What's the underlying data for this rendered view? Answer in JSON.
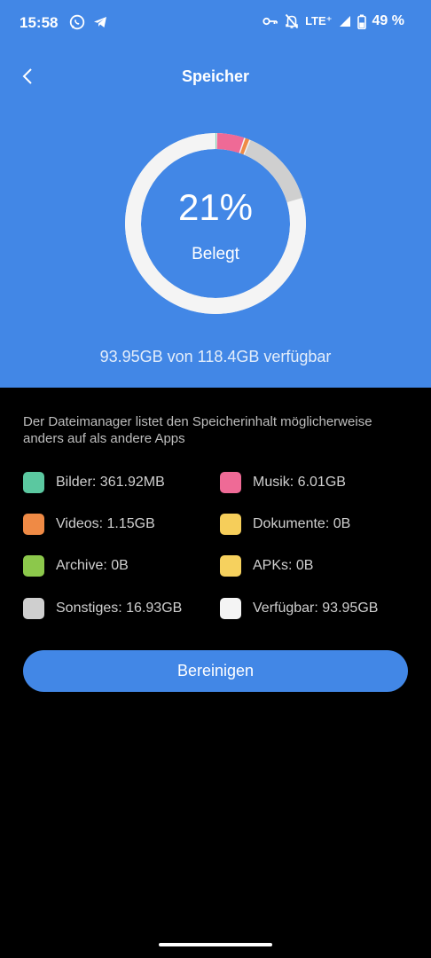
{
  "status_bar": {
    "time": "15:58",
    "network": "LTE⁺",
    "battery": "49 %",
    "left_icons": [
      "whatsapp-icon",
      "telegram-icon"
    ],
    "right_icons": [
      "vpn-key-icon",
      "bell-off-icon",
      "signal-icon",
      "battery-icon"
    ]
  },
  "header": {
    "title": "Speicher",
    "back_icon": "chevron-left-icon"
  },
  "storage": {
    "percent_label": "21%",
    "used_label": "Belegt",
    "available_text": "93.95GB von 118.4GB verfügbar"
  },
  "chart_data": {
    "type": "pie",
    "title": "",
    "center_text": "21%",
    "center_subtext": "Belegt",
    "slices": [
      {
        "name": "Bilder",
        "value_gb": 0.36192,
        "color": "#5BC8A0"
      },
      {
        "name": "Musik",
        "value_gb": 6.01,
        "color": "#EF6A96"
      },
      {
        "name": "Videos",
        "value_gb": 1.15,
        "color": "#EF8A45"
      },
      {
        "name": "Dokumente",
        "value_gb": 0,
        "color": "#F6CE5A"
      },
      {
        "name": "Archive",
        "value_gb": 0,
        "color": "#8CC84B"
      },
      {
        "name": "APKs",
        "value_gb": 0,
        "color": "#F6D15E"
      },
      {
        "name": "Sonstiges",
        "value_gb": 16.93,
        "color": "#CFCFCF"
      },
      {
        "name": "Verfügbar",
        "value_gb": 93.95,
        "color": "#F4F4F4"
      }
    ],
    "total_gb": 118.4
  },
  "note": "Der Dateimanager listet den Speicherinhalt möglicherweise anders auf als andere Apps",
  "legend": [
    {
      "label": "Bilder: 361.92MB",
      "color": "#5BC8A0"
    },
    {
      "label": "Musik: 6.01GB",
      "color": "#EF6A96"
    },
    {
      "label": "Videos: 1.15GB",
      "color": "#EF8A45"
    },
    {
      "label": "Dokumente: 0B",
      "color": "#F6CE5A"
    },
    {
      "label": "Archive: 0B",
      "color": "#8CC84B"
    },
    {
      "label": "APKs: 0B",
      "color": "#F6D15E"
    },
    {
      "label": "Sonstiges: 16.93GB",
      "color": "#CFCFCF"
    },
    {
      "label": "Verfügbar: 93.95GB",
      "color": "#F4F4F4"
    }
  ],
  "actions": {
    "clean_label": "Bereinigen"
  },
  "colors": {
    "accent": "#4287E6",
    "background": "#000000"
  }
}
